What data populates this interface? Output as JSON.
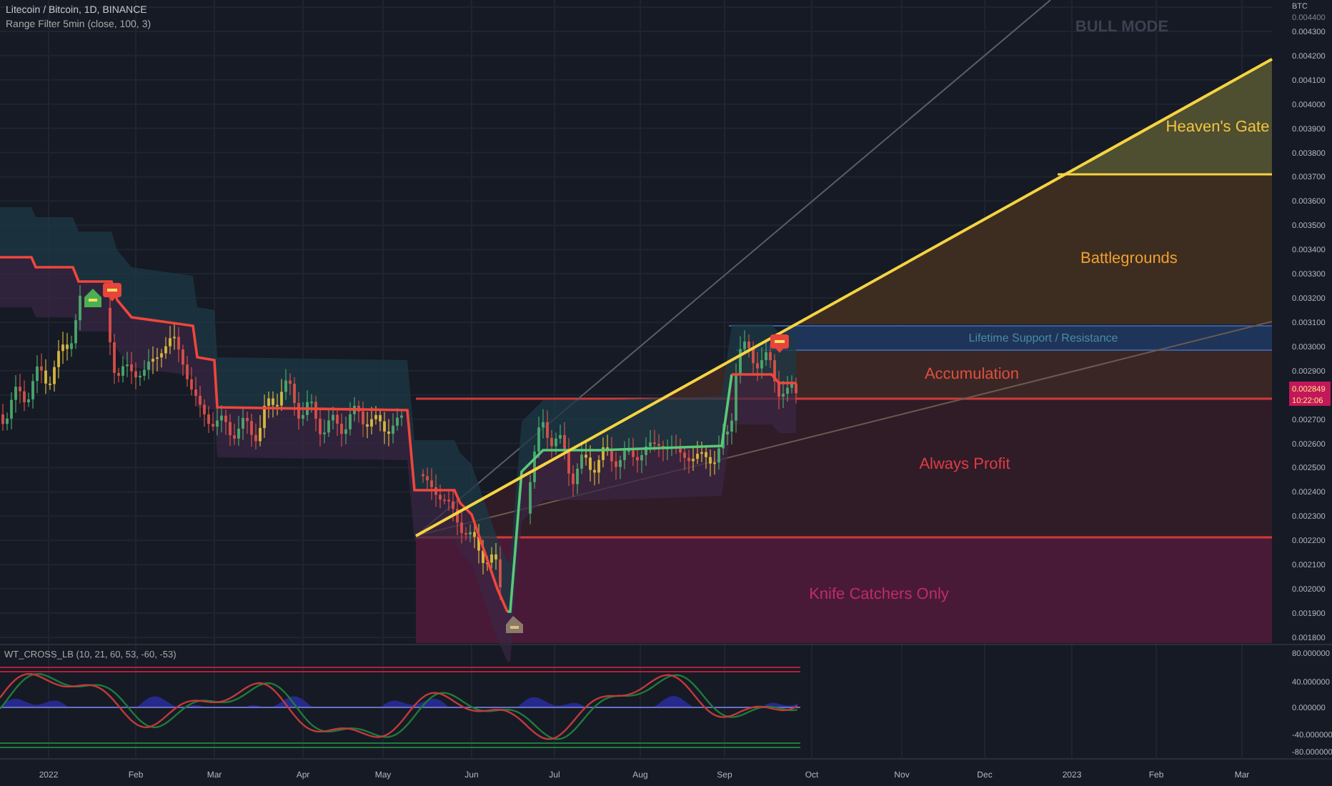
{
  "header": {
    "symbol": "Litecoin / Bitcoin, 1D, BINANCE",
    "indicator": "Range Filter  5min (close, 100, 3)"
  },
  "mode_label": "BULL MODE",
  "zones": [
    {
      "label": "Heaven's Gate",
      "color": "#f5c542"
    },
    {
      "label": "Battlegrounds",
      "color": "#f0a030"
    },
    {
      "label": "Lifetime Support / Resistance",
      "color": "#4a8aa0"
    },
    {
      "label": "Accumulation",
      "color": "#e0503c"
    },
    {
      "label": "Always Profit",
      "color": "#e03c46"
    },
    {
      "label": "Knife Catchers Only",
      "color": "#c02c68"
    }
  ],
  "price_axis": {
    "unit": "BTC",
    "ticks": [
      "0.004400",
      "0.004300",
      "0.004200",
      "0.004100",
      "0.004000",
      "0.003900",
      "0.003800",
      "0.003700",
      "0.003600",
      "0.003500",
      "0.003400",
      "0.003300",
      "0.003200",
      "0.003100",
      "0.003000",
      "0.002900",
      "0.002700",
      "0.002600",
      "0.002500",
      "0.002400",
      "0.002300",
      "0.002200",
      "0.002100",
      "0.002000",
      "0.001900",
      "0.001800"
    ]
  },
  "last_price": {
    "value": "0.002849",
    "countdown": "10:22:06"
  },
  "oscillator": {
    "title": "WT_CROSS_LB (10, 21, 60, 53, -60, -53)",
    "ticks": [
      "80.000000",
      "40.000000",
      "0.000000",
      "-40.000000",
      "-80.000000"
    ]
  },
  "time_axis": {
    "ticks": [
      "2022",
      "Feb",
      "Mar",
      "Apr",
      "May",
      "Jun",
      "Jul",
      "Aug",
      "Sep",
      "Oct",
      "Nov",
      "Dec",
      "2023",
      "Feb",
      "Mar"
    ]
  }
}
